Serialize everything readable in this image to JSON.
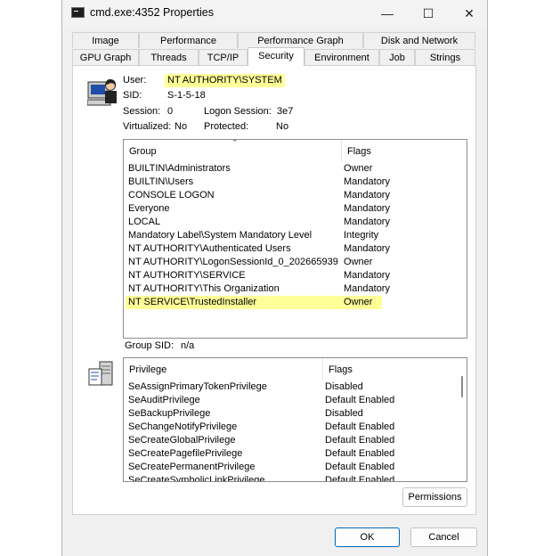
{
  "window": {
    "title": "cmd.exe:4352 Properties"
  },
  "tabs_row1": [
    "Image",
    "Performance",
    "Performance Graph",
    "Disk and Network"
  ],
  "tabs_row2": [
    "GPU Graph",
    "Threads",
    "TCP/IP",
    "Security",
    "Environment",
    "Job",
    "Strings"
  ],
  "active_tab": "Security",
  "user_info": {
    "user_label": "User:",
    "user_value": "NT AUTHORITY\\SYSTEM",
    "sid_label": "SID:",
    "sid_value": "S-1-5-18",
    "session_label": "Session:",
    "session_value": "0",
    "logon_label": "Logon Session:",
    "logon_value": "3e7",
    "virtualized_label": "Virtualized:",
    "virtualized_value": "No",
    "protected_label": "Protected:",
    "protected_value": "No"
  },
  "groups": {
    "headers": [
      "Group",
      "Flags"
    ],
    "rows": [
      [
        "BUILTIN\\Administrators",
        "Owner"
      ],
      [
        "BUILTIN\\Users",
        "Mandatory"
      ],
      [
        "CONSOLE LOGON",
        "Mandatory"
      ],
      [
        "Everyone",
        "Mandatory"
      ],
      [
        "LOCAL",
        "Mandatory"
      ],
      [
        "Mandatory Label\\System Mandatory Level",
        "Integrity"
      ],
      [
        "NT AUTHORITY\\Authenticated Users",
        "Mandatory"
      ],
      [
        "NT AUTHORITY\\LogonSessionId_0_202665939",
        "Owner"
      ],
      [
        "NT AUTHORITY\\SERVICE",
        "Mandatory"
      ],
      [
        "NT AUTHORITY\\This Organization",
        "Mandatory"
      ],
      [
        "NT SERVICE\\TrustedInstaller",
        "Owner"
      ]
    ]
  },
  "group_sid": {
    "label": "Group SID:",
    "value": "n/a"
  },
  "privileges": {
    "headers": [
      "Privilege",
      "Flags"
    ],
    "rows": [
      [
        "SeAssignPrimaryTokenPrivilege",
        "Disabled"
      ],
      [
        "SeAuditPrivilege",
        "Default Enabled"
      ],
      [
        "SeBackupPrivilege",
        "Disabled"
      ],
      [
        "SeChangeNotifyPrivilege",
        "Default Enabled"
      ],
      [
        "SeCreateGlobalPrivilege",
        "Default Enabled"
      ],
      [
        "SeCreatePagefilePrivilege",
        "Default Enabled"
      ],
      [
        "SeCreatePermanentPrivilege",
        "Default Enabled"
      ],
      [
        "SeCreateSymbolicLinkPrivilege",
        "Default Enabled"
      ]
    ]
  },
  "buttons": {
    "permissions": "Permissions",
    "ok": "OK",
    "cancel": "Cancel"
  },
  "controls": {
    "minimize": "—",
    "maximize": "☐",
    "close": "✕"
  },
  "colors": {
    "highlight": "#ffff99",
    "primary_border": "#0067c0"
  }
}
